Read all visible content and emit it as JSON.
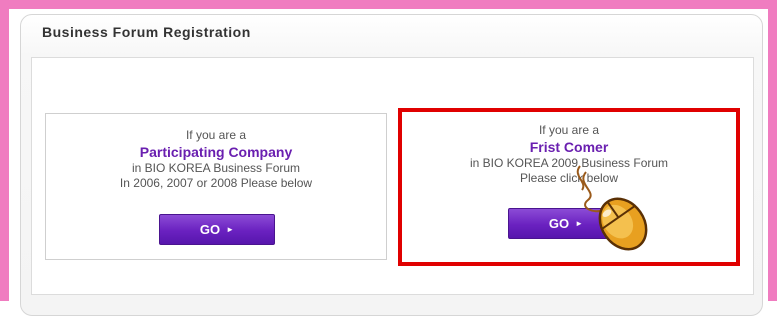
{
  "panel": {
    "title": "Business Forum Registration"
  },
  "options": [
    {
      "line1": "If you are a",
      "highlight": "Participating Company",
      "line2": "in BIO KOREA Business Forum",
      "line3": "In 2006, 2007 or 2008 Please below",
      "button": "GO"
    },
    {
      "line1": "If you are a",
      "highlight": "Frist Comer",
      "line2": "in BIO KOREA 2009 Business Forum",
      "line3": "Please click below",
      "button": "GO"
    }
  ],
  "colors": {
    "frame": "#f07cc0",
    "highlight_text": "#6a1fb0",
    "button": "#6a21c0",
    "selection_border": "#e00000"
  },
  "icons": {
    "button_arrow": "arrow-right-icon",
    "cursor_overlay": "mouse-icon"
  }
}
